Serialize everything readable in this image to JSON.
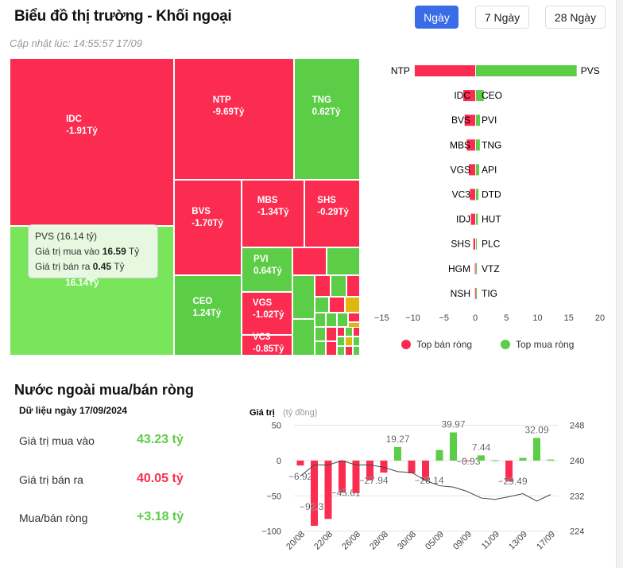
{
  "header": {
    "title": "Biểu đồ thị trường - Khối ngoại",
    "updated": "Cập nhật lúc: 14:55:57 17/09",
    "tabs": [
      {
        "label": "Ngày",
        "active": true
      },
      {
        "label": "7 Ngày",
        "active": false
      },
      {
        "label": "28 Ngày",
        "active": false
      }
    ]
  },
  "colors": {
    "sell": "#fb2c50",
    "buy": "#5ccd46",
    "accent": "#3b6ce8"
  },
  "treemap": {
    "tiles": [
      {
        "symbol": "IDC",
        "value": "-1.91Tỷ",
        "side": "sell"
      },
      {
        "symbol": "PVS",
        "value": "16.14Tỷ",
        "side": "buy"
      },
      {
        "symbol": "NTP",
        "value": "-9.69Tỷ",
        "side": "sell"
      },
      {
        "symbol": "TNG",
        "value": "0.62Tỷ",
        "side": "buy"
      },
      {
        "symbol": "BVS",
        "value": "-1.70Tỷ",
        "side": "sell"
      },
      {
        "symbol": "MBS",
        "value": "-1.34Tỷ",
        "side": "sell"
      },
      {
        "symbol": "SHS",
        "value": "-0.29Tỷ",
        "side": "sell"
      },
      {
        "symbol": "CEO",
        "value": "1.24Tỷ",
        "side": "buy"
      },
      {
        "symbol": "PVI",
        "value": "0.64Tỷ",
        "side": "buy"
      },
      {
        "symbol": "VGS",
        "value": "-1.02Tỷ",
        "side": "sell"
      },
      {
        "symbol": "VC3",
        "value": "-0.85Tỷ",
        "side": "sell"
      }
    ],
    "tooltip": {
      "title": "PVS (16.14 tỷ)",
      "buy_label": "Giá trị mua vào",
      "buy_value": "16.59",
      "sell_label": "Giá trị bán ra",
      "sell_value": "0.45",
      "unit": "Tỷ"
    }
  },
  "chart_data": [
    {
      "type": "bar",
      "orientation": "horizontal",
      "xlim": [
        -15,
        20
      ],
      "xticks": [
        "−15",
        "−10",
        "−5",
        "0",
        "5",
        "10",
        "15",
        "20"
      ],
      "sell_labels": [
        "NTP",
        "IDC",
        "BVS",
        "MBS",
        "VGS",
        "VC3",
        "IDJ",
        "SHS",
        "HGM",
        "NSH"
      ],
      "sell_values": [
        -9.69,
        -1.91,
        -1.7,
        -1.34,
        -1.02,
        -0.85,
        -0.7,
        -0.29,
        -0.05,
        -0.03
      ],
      "buy_labels": [
        "PVS",
        "CEO",
        "PVI",
        "TNG",
        "API",
        "DTD",
        "HUT",
        "PLC",
        "VTZ",
        "TIG"
      ],
      "buy_values": [
        16.14,
        1.24,
        0.64,
        0.62,
        0.5,
        0.4,
        0.3,
        0.1,
        0.1,
        0.05
      ],
      "legend": [
        "Top bán ròng",
        "Top mua ròng"
      ],
      "legend_position": "bottom"
    },
    {
      "type": "bar+line",
      "ylabel": "Giá trị",
      "ylabel_unit": "(tỷ đồng)",
      "ylim": [
        -100,
        50
      ],
      "yticks": [
        "50",
        "0",
        "−50",
        "−100"
      ],
      "y2lim": [
        224,
        248
      ],
      "y2ticks": [
        "248",
        "240",
        "232",
        "224"
      ],
      "categories": [
        "20/08",
        "21/08",
        "22/08",
        "23/08",
        "26/08",
        "27/08",
        "28/08",
        "29/08",
        "30/08",
        "04/09",
        "05/09",
        "06/09",
        "09/09",
        "10/09",
        "11/09",
        "12/09",
        "13/09",
        "16/09",
        "17/09"
      ],
      "xtick_labels": [
        "20/08",
        "22/08",
        "26/08",
        "28/08",
        "30/08",
        "05/09",
        "09/09",
        "11/09",
        "13/09",
        "17/09"
      ],
      "values": [
        -6.92,
        -92.37,
        -82.7,
        -45.61,
        -46,
        -27.94,
        -17,
        19.27,
        -18,
        -28.14,
        15,
        39.97,
        -0.93,
        7.44,
        0.5,
        -29.49,
        3.8,
        32.09,
        1.5
      ],
      "data_labels": [
        "−6.92",
        "−92.37",
        "",
        "−45.61",
        "",
        "−27.94",
        "",
        "19.27",
        "",
        "−28.14",
        "",
        "39.97",
        "−0.93",
        "7.44",
        "",
        "−29.49",
        "",
        "32.09",
        ""
      ],
      "line_values": [
        236.5,
        239,
        239,
        240,
        239,
        239,
        238.5,
        237.5,
        237.3,
        235.5,
        234.3,
        234,
        233,
        231.5,
        231.2,
        231.8,
        232.5,
        230.8,
        232.3
      ],
      "grid": true
    }
  ],
  "summary": {
    "title": "Nước ngoài mua/bán ròng",
    "date": "Dữ liệu ngày 17/09/2024",
    "rows": [
      {
        "label": "Giá trị mua vào",
        "value": "43.23 tỷ",
        "side": "buy"
      },
      {
        "label": "Giá trị bán ra",
        "value": "40.05 tỷ",
        "side": "sell"
      },
      {
        "label": "Mua/bán ròng",
        "value": "+3.18 tỷ",
        "side": "buy"
      }
    ]
  }
}
